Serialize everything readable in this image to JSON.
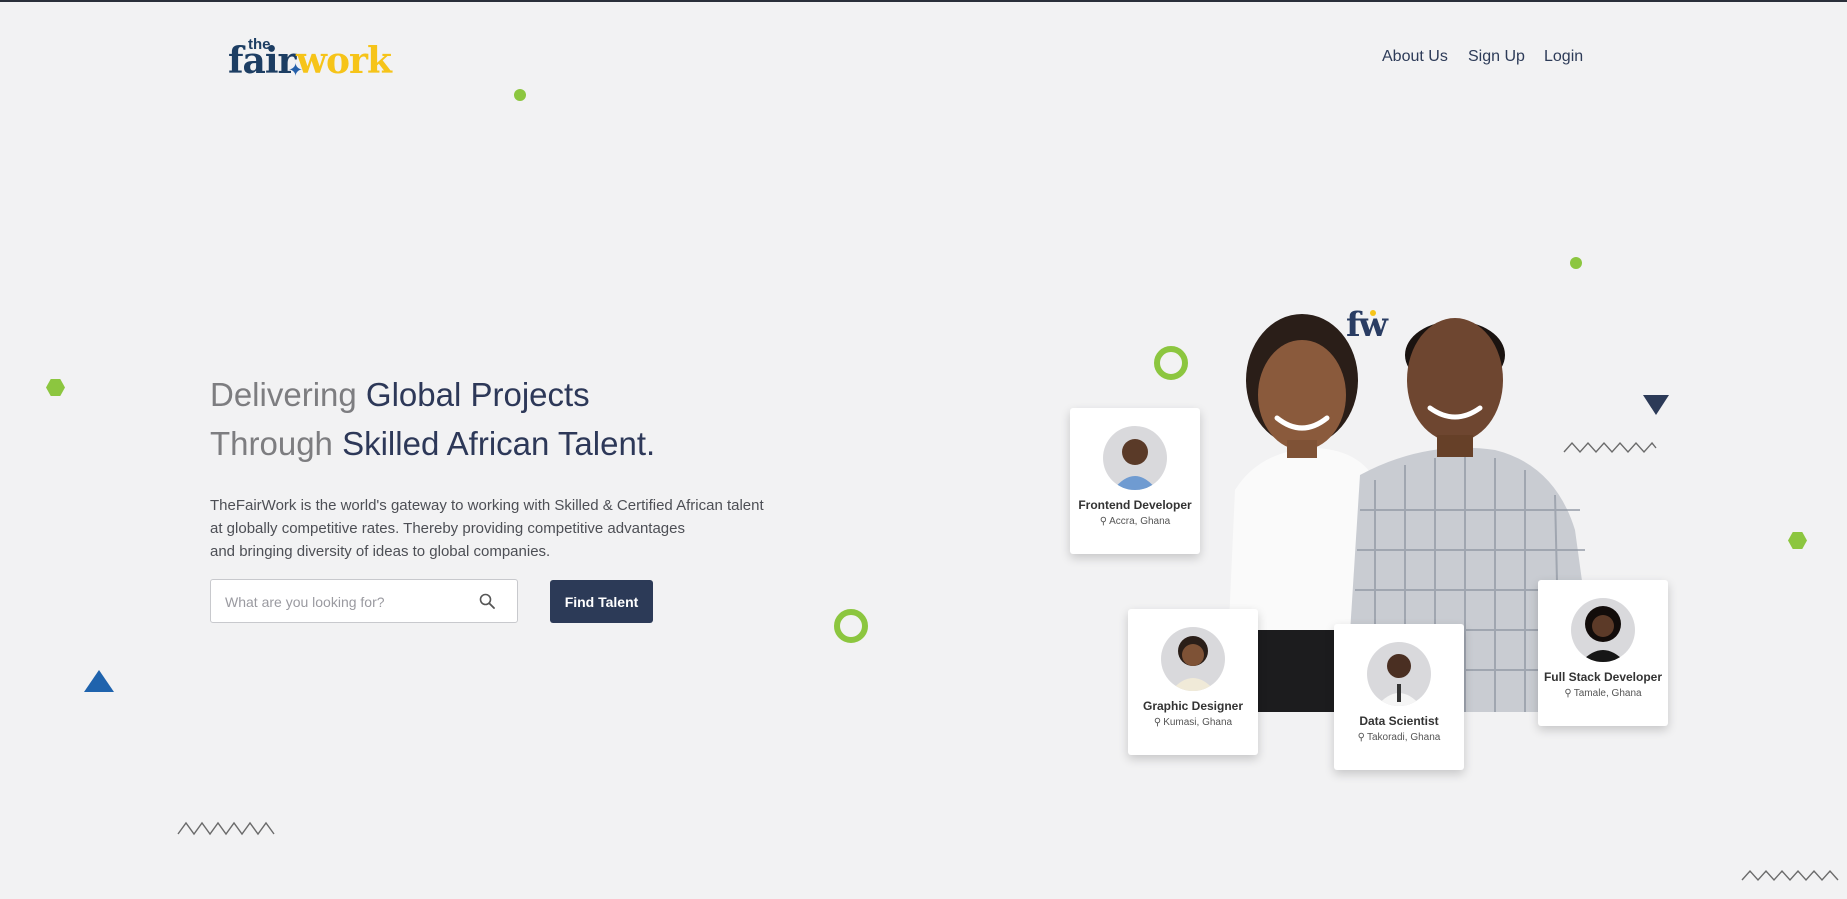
{
  "header": {
    "logo": {
      "the": "the",
      "fair": "fair",
      "work": "work"
    },
    "nav": [
      "About Us",
      "Sign Up",
      "Login"
    ]
  },
  "hero": {
    "line1_muted": "Delivering ",
    "line1_strong": "Global Projects",
    "line2_muted": "Through ",
    "line2_strong": "Skilled African Talent.",
    "description": [
      "TheFairWork is the world's gateway to working with Skilled & Certified African talent",
      "at globally competitive rates. Thereby providing competitive advantages",
      "and bringing diversity of ideas to global companies."
    ]
  },
  "search": {
    "placeholder": "What are you looking for?",
    "value": "",
    "button": "Find Talent"
  },
  "illustration": {
    "brand_mark": "fw",
    "cards": [
      {
        "role": "Frontend Developer",
        "location": "Accra, Ghana"
      },
      {
        "role": "Graphic Designer",
        "location": "Kumasi, Ghana"
      },
      {
        "role": "Data Scientist",
        "location": "Takoradi, Ghana"
      },
      {
        "role": "Full Stack Developer",
        "location": "Tamale, Ghana"
      }
    ]
  },
  "colors": {
    "navy": "#2c3a57",
    "green_accent": "#8cc63f",
    "yellow_brand": "#f6c419",
    "blue_triangle": "#1f63ad",
    "background": "#f2f2f3"
  },
  "icons": [
    "search-icon",
    "location-pin-icon",
    "star-icon"
  ]
}
